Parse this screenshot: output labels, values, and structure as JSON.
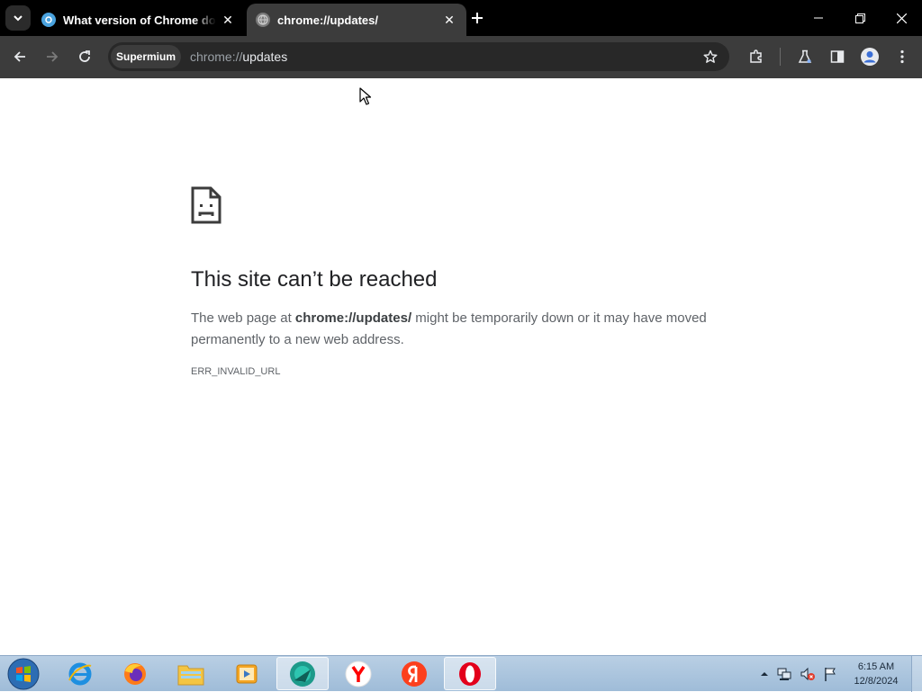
{
  "browser": {
    "tabs": [
      {
        "title": "What version of Chrome do I have",
        "close": "✕",
        "active": false
      },
      {
        "title": "chrome://updates/",
        "close": "✕",
        "active": true
      }
    ],
    "new_tab_icon": "plus-icon",
    "window_controls": [
      "minimize-icon",
      "restore-icon",
      "close-icon"
    ]
  },
  "toolbar": {
    "chip_label": "Supermium",
    "url_scheme": "chrome://",
    "url_path": "updates",
    "icons": [
      "back-arrow-icon",
      "forward-arrow-icon",
      "reload-icon",
      "star-icon",
      "extensions-icon",
      "labs-flask-icon",
      "side-panel-icon",
      "profile-avatar-icon",
      "kebab-menu-icon"
    ]
  },
  "page": {
    "heading": "This site can’t be reached",
    "desc_prefix": "The web page at ",
    "desc_url": "chrome://updates/",
    "desc_suffix": " might be temporarily down or it may have moved permanently to a new web address.",
    "error_code": "ERR_INVALID_URL"
  },
  "taskbar": {
    "apps": [
      "internet-explorer-icon",
      "firefox-icon",
      "file-explorer-icon",
      "media-player-icon",
      "supermium-icon",
      "yandex-y-icon",
      "yandex-ya-icon",
      "opera-icon"
    ],
    "tray_icons": [
      "tray-expand-icon",
      "network-icon",
      "volume-muted-icon",
      "action-center-flag-icon"
    ],
    "time": "6:15 AM",
    "date": "12/8/2024"
  },
  "colors": {
    "titlebar": "#000000",
    "toolbar": "#3c3c3c",
    "omnibox": "#282828",
    "heading": "#202124",
    "body_text": "#5f6368",
    "taskbar": "#b9cfe4"
  }
}
